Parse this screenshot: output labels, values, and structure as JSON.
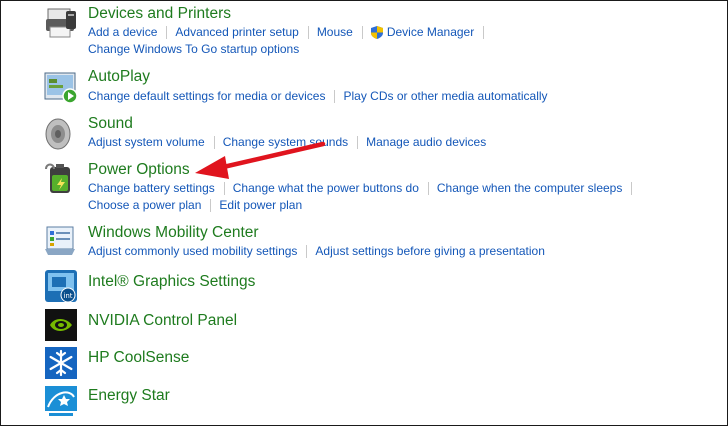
{
  "items": [
    {
      "title": "Devices and Printers",
      "links": [
        [
          "Add a device",
          "Advanced printer setup",
          "Mouse",
          "Device Manager"
        ],
        [
          "Change Windows To Go startup options"
        ]
      ]
    },
    {
      "title": "AutoPlay",
      "links": [
        [
          "Change default settings for media or devices",
          "Play CDs or other media automatically"
        ]
      ]
    },
    {
      "title": "Sound",
      "links": [
        [
          "Adjust system volume",
          "Change system sounds",
          "Manage audio devices"
        ]
      ]
    },
    {
      "title": "Power Options",
      "links": [
        [
          "Change battery settings",
          "Change what the power buttons do",
          "Change when the computer sleeps"
        ],
        [
          "Choose a power plan",
          "Edit power plan"
        ]
      ]
    },
    {
      "title": "Windows Mobility Center",
      "links": [
        [
          "Adjust commonly used mobility settings",
          "Adjust settings before giving a presentation"
        ]
      ]
    },
    {
      "title": "Intel® Graphics Settings",
      "links": []
    },
    {
      "title": "NVIDIA Control Panel",
      "links": []
    },
    {
      "title": "HP CoolSense",
      "links": []
    },
    {
      "title": "Energy Star",
      "links": []
    }
  ],
  "icons": {
    "devices": "printer-icon",
    "autoplay": "autoplay-icon",
    "sound": "speaker-icon",
    "power": "battery-power-icon",
    "mobility": "mobility-center-icon",
    "intel": "intel-graphics-icon",
    "nvidia": "nvidia-icon",
    "coolsense": "snowflake-icon",
    "energystar": "energy-star-icon"
  },
  "colors": {
    "title": "#1e7b1e",
    "link": "#1457b8",
    "annotation_arrow": "#e0141e"
  }
}
